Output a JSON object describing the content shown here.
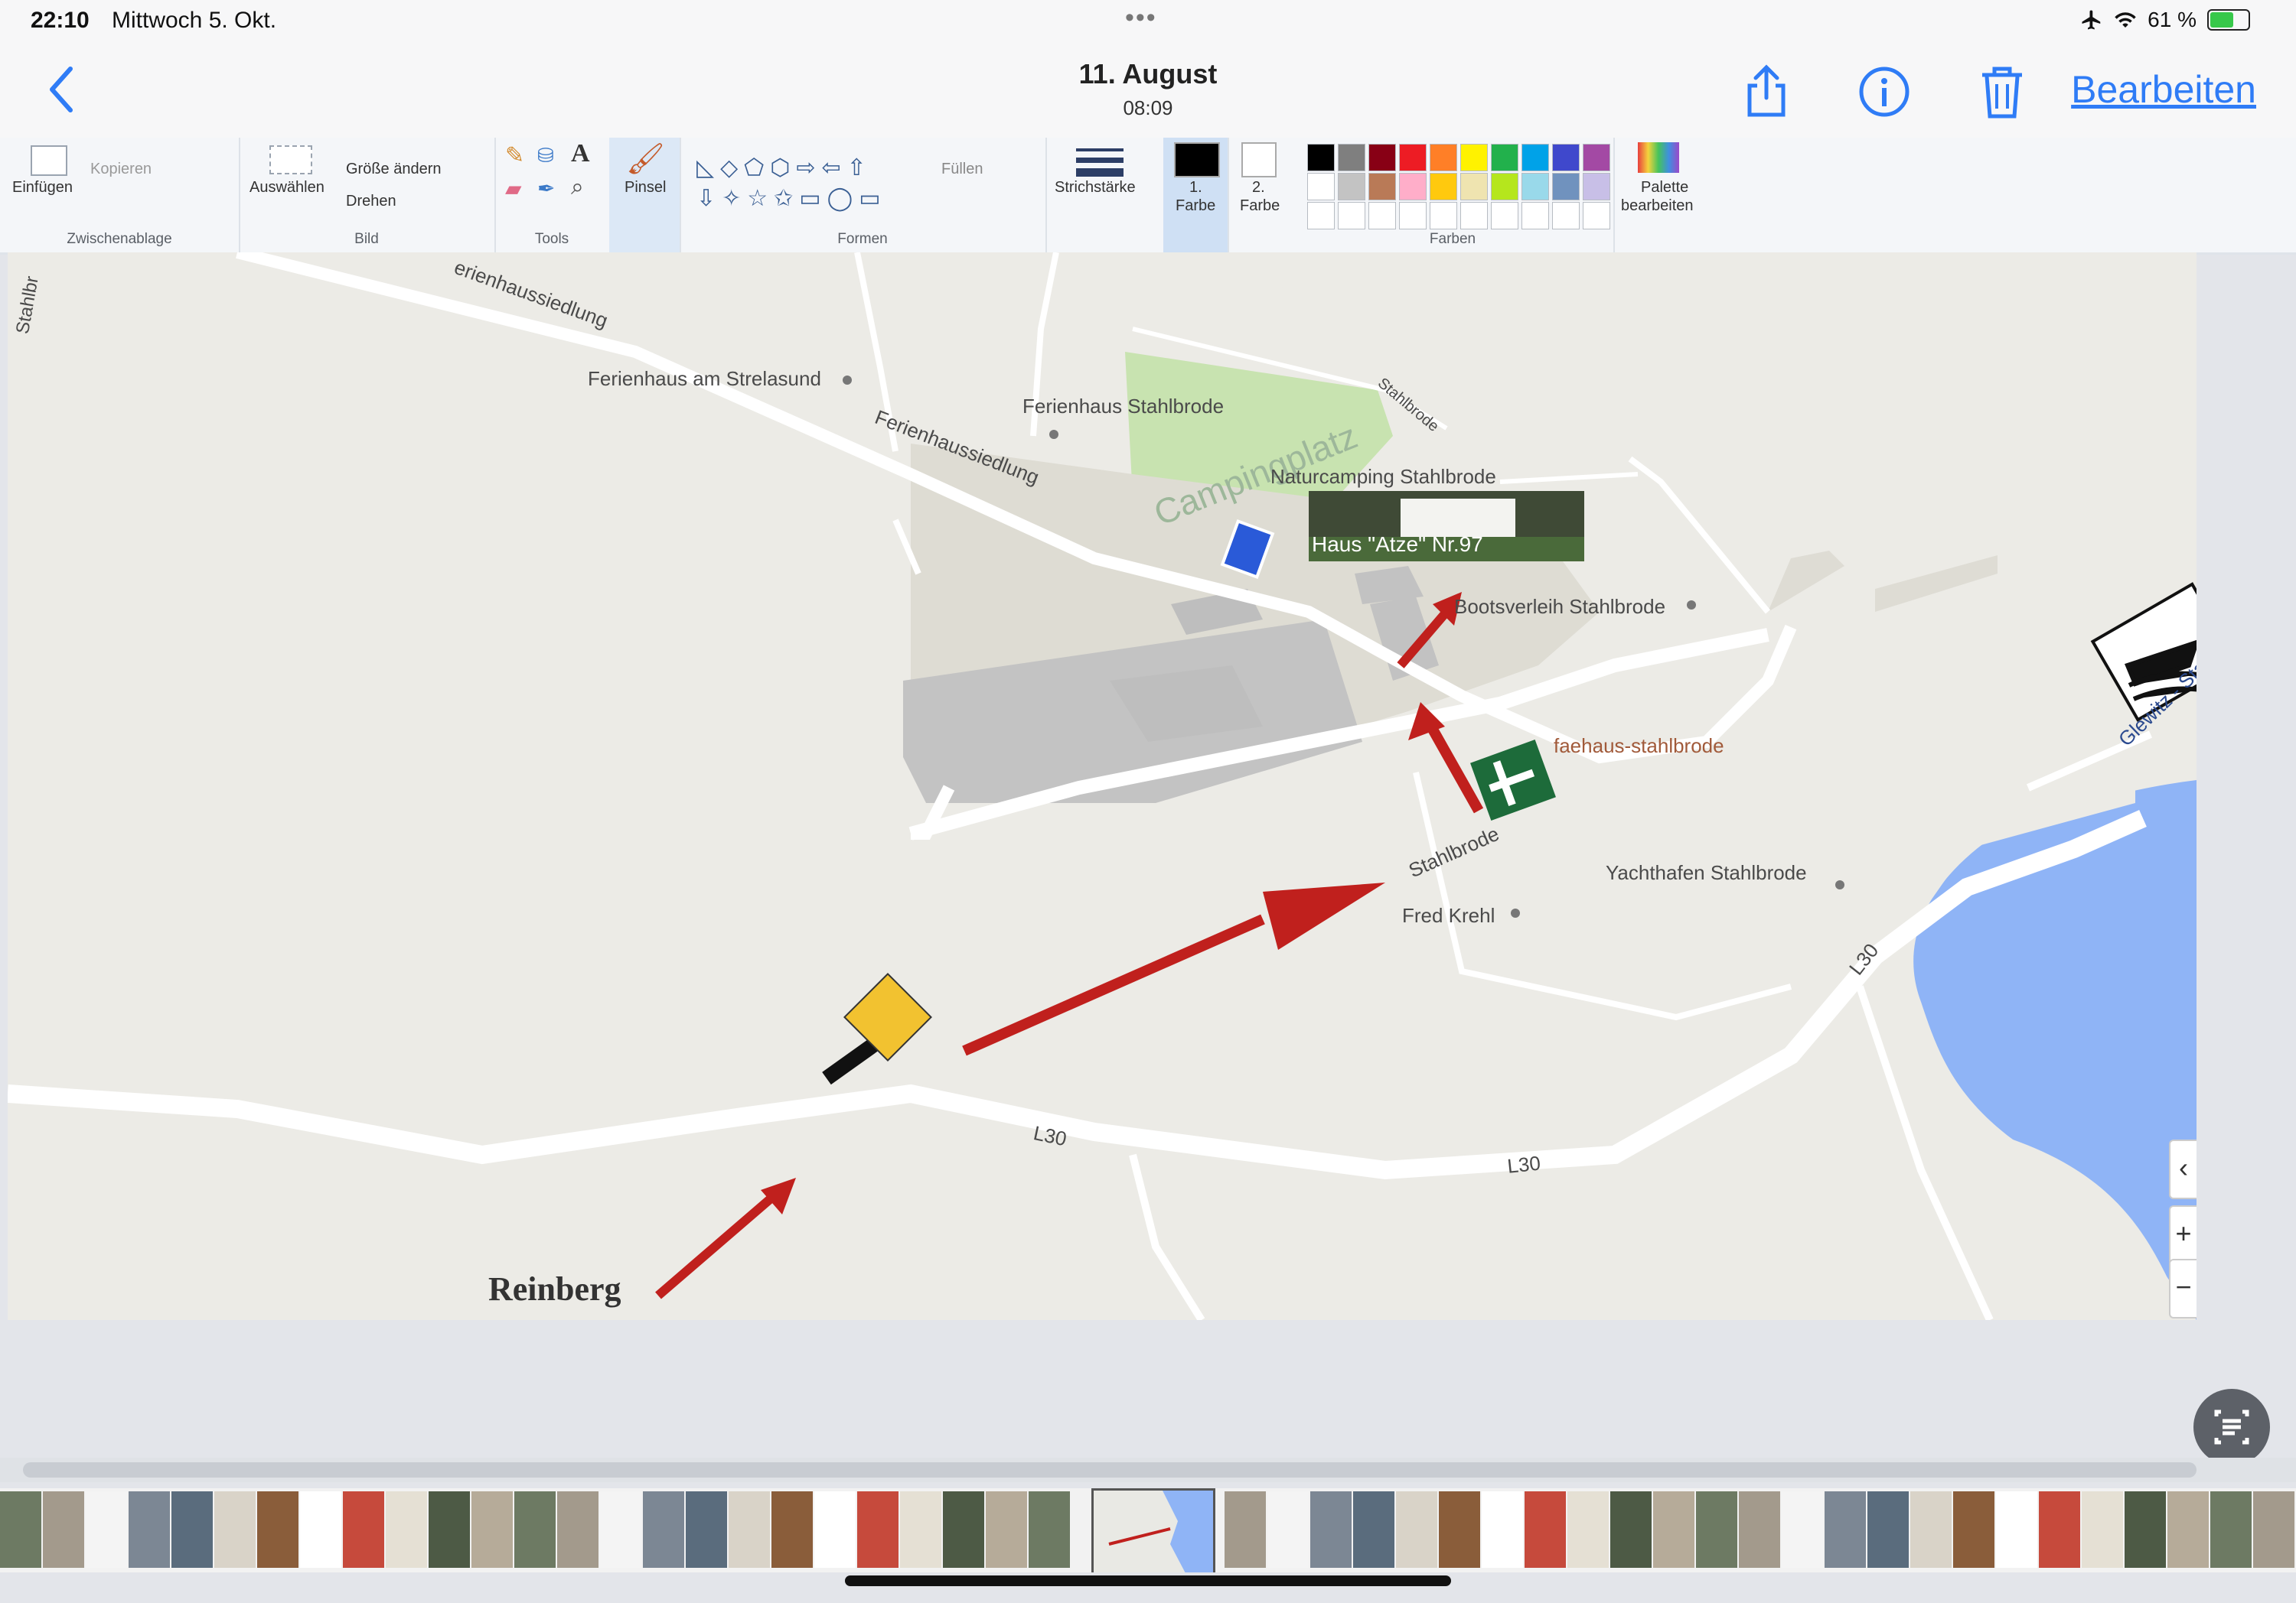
{
  "status_bar": {
    "time": "22:10",
    "date": "Mittwoch 5. Okt.",
    "dots": "•••",
    "battery": "61 %",
    "icons": [
      "airplane-icon",
      "wifi-icon",
      "battery-charging-icon"
    ]
  },
  "nav": {
    "title": "11. August",
    "subtitle": "08:09",
    "edit_label": "Bearbeiten",
    "icons": [
      "back-chevron-icon",
      "share-icon",
      "info-icon",
      "trash-icon"
    ]
  },
  "ribbon": {
    "clipboard": {
      "paste": "Einfügen",
      "copy": "Kopieren",
      "caption": "Zwischenablage"
    },
    "image": {
      "select": "Auswählen",
      "resize": "Größe ändern",
      "rotate": "Drehen",
      "caption": "Bild"
    },
    "tools": {
      "caption": "Tools"
    },
    "brush": "Pinsel",
    "shapes": {
      "fill": "Füllen",
      "caption": "Formen"
    },
    "stroke": "Strichstärke",
    "color1": [
      "1.",
      "Farbe"
    ],
    "color2": [
      "2.",
      "Farbe"
    ],
    "colors_caption": "Farben",
    "edit_palette": [
      "Palette",
      "bearbeiten"
    ],
    "palette_top": [
      "#000000",
      "#7f7f7f",
      "#880015",
      "#ed1c24",
      "#ff7f27",
      "#fff200",
      "#22b14c",
      "#00a2e8",
      "#3f48cc",
      "#a349a4"
    ],
    "palette_mid": [
      "#ffffff",
      "#c3c3c3",
      "#b97a57",
      "#ffaec9",
      "#ffc90e",
      "#efe4b0",
      "#b5e61d",
      "#99d9ea",
      "#7092be",
      "#c8bfe7"
    ]
  },
  "map": {
    "water_color": "#8fb4f6",
    "land_color": "#ecebe6",
    "arrow_color": "#c0201d",
    "labels": {
      "stahlbr_corner": "Stahlbr",
      "ferienhaussiedlung_top": "erienhaussiedlung",
      "ferienhaus_strelasund": "Ferienhaus am Strelasund",
      "ferienhaus_stahlbrode": "Ferienhaus Stahlbrode",
      "ferienhaussiedlung": "Ferienhaussiedlung",
      "campingplatz": "Campingplatz",
      "naturcamping": "Naturcamping Stahlbrode",
      "haus_label": "Haus \"Atze\" Nr.97",
      "stahlbrode_road": "Stahlbrode",
      "bootsverleih": "Bootsverleih Stahlbrode",
      "faehrhaus": "faehaus-stahlbrode",
      "stahlbrode_street": "Stahlbrode",
      "yachthafen": "Yachthafen Stahlbrode",
      "fred_krehl": "Fred Krehl",
      "l30_a": "L30",
      "l30_b": "L30",
      "l30_c": "L30",
      "glewitz": "Glewitz - Stahl",
      "reinberg": "Reinberg"
    }
  },
  "side_controls": [
    "‹",
    "+",
    "−"
  ]
}
